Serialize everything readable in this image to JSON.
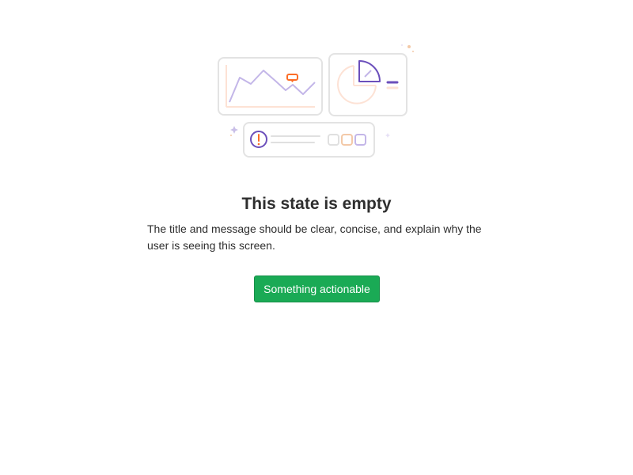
{
  "empty_state": {
    "title": "This state is empty",
    "message": "The title and message should be clear, concise, and explain why the user is seeing this screen.",
    "action_label": "Something actionable"
  },
  "colors": {
    "primary_button": "#1aaa55",
    "illustration_purple": "#6b4fbb",
    "illustration_orange": "#fc6d26",
    "card_border": "#dbdbdb"
  }
}
